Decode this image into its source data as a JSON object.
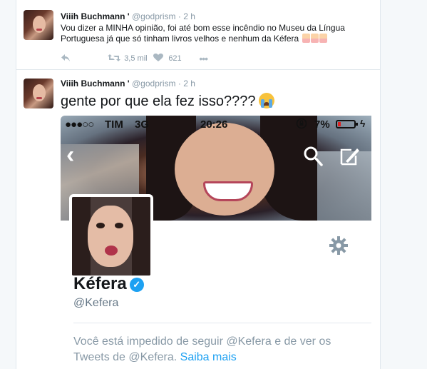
{
  "tweets": [
    {
      "author_name": "Viiih Buchmann '",
      "handle": "@godprism",
      "separator": "·",
      "time": "2 h",
      "text": "Vou dizer a MINHA opinião, foi até bom esse incêndio no Museu da Língua Portuguesa já que só tinham livros velhos e nenhum da Kéfera",
      "actions": {
        "reply_icon": "reply-icon",
        "retweet_icon": "retweet-icon",
        "retweet_count": "3,5 mil",
        "like_icon": "heart-icon",
        "like_count": "621",
        "more_icon": "more-icon"
      }
    },
    {
      "author_name": "Viiih Buchmann '",
      "handle": "@godprism",
      "separator": "·",
      "time": "2 h",
      "text": "gente por que ela fez isso????"
    }
  ],
  "screenshot": {
    "status": {
      "signal": "●●●○○",
      "carrier": "TIM",
      "network": "3G",
      "clock": "20:26",
      "battery_pct": "7%"
    },
    "profile": {
      "name": "Kéfera",
      "handle": "@Kefera",
      "blocked_text": "Você está impedido de seguir @Kefera e de ver os Tweets de @Kefera.",
      "learn_more": "Saiba mais"
    }
  },
  "colors": {
    "link": "#1da1f2",
    "muted": "#8899a6",
    "text": "#14171a"
  }
}
